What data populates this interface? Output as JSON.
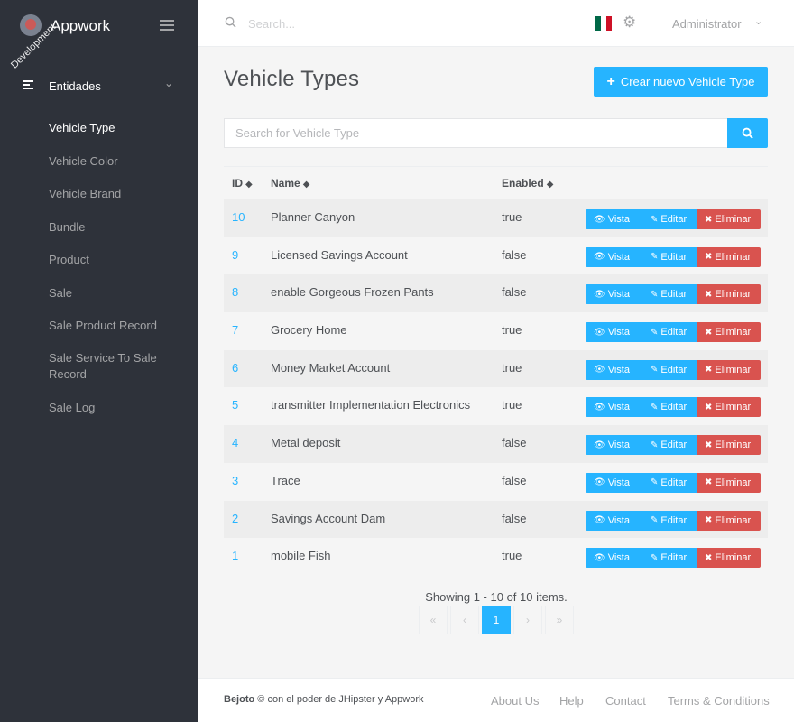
{
  "brand": {
    "name": "Appwork",
    "ribbon": "Development"
  },
  "sidebar": {
    "group_label": "Entidades",
    "items": [
      {
        "label": "Vehicle Type",
        "active": true
      },
      {
        "label": "Vehicle Color"
      },
      {
        "label": "Vehicle Brand"
      },
      {
        "label": "Bundle"
      },
      {
        "label": "Product"
      },
      {
        "label": "Sale"
      },
      {
        "label": "Sale Product Record"
      },
      {
        "label": "Sale Service To Sale Record"
      },
      {
        "label": "Sale Log"
      }
    ]
  },
  "topbar": {
    "search_placeholder": "Search...",
    "user": "Administrator",
    "flag_colors": [
      "#006847",
      "#ffffff",
      "#ce1126"
    ]
  },
  "page": {
    "title": "Vehicle Types",
    "create_button": "Crear nuevo Vehicle Type",
    "search_placeholder": "Search for Vehicle Type"
  },
  "table": {
    "headers": {
      "id": "ID",
      "name": "Name",
      "enabled": "Enabled"
    },
    "actions": {
      "view": "Vista",
      "edit": "Editar",
      "delete": "Eliminar"
    },
    "rows": [
      {
        "id": "10",
        "name": "Planner Canyon",
        "enabled": "true"
      },
      {
        "id": "9",
        "name": "Licensed Savings Account",
        "enabled": "false"
      },
      {
        "id": "8",
        "name": "enable Gorgeous Frozen Pants",
        "enabled": "false"
      },
      {
        "id": "7",
        "name": "Grocery Home",
        "enabled": "true"
      },
      {
        "id": "6",
        "name": "Money Market Account",
        "enabled": "true"
      },
      {
        "id": "5",
        "name": "transmitter Implementation Electronics",
        "enabled": "true"
      },
      {
        "id": "4",
        "name": "Metal deposit",
        "enabled": "false"
      },
      {
        "id": "3",
        "name": "Trace",
        "enabled": "false"
      },
      {
        "id": "2",
        "name": "Savings Account Dam",
        "enabled": "false"
      },
      {
        "id": "1",
        "name": "mobile Fish",
        "enabled": "true"
      }
    ]
  },
  "pagination": {
    "info": "Showing 1 - 10 of 10 items.",
    "first": "«",
    "prev": "‹",
    "current": "1",
    "next": "›",
    "last": "»"
  },
  "footer": {
    "brand": "Bejoto",
    "copyright": "© con el poder de JHipster y Appwork",
    "links": [
      "About Us",
      "Help",
      "Contact",
      "Terms & Conditions"
    ]
  },
  "colors": {
    "primary": "#26b4ff",
    "danger": "#d9534f",
    "sidebar": "#2e323a"
  }
}
